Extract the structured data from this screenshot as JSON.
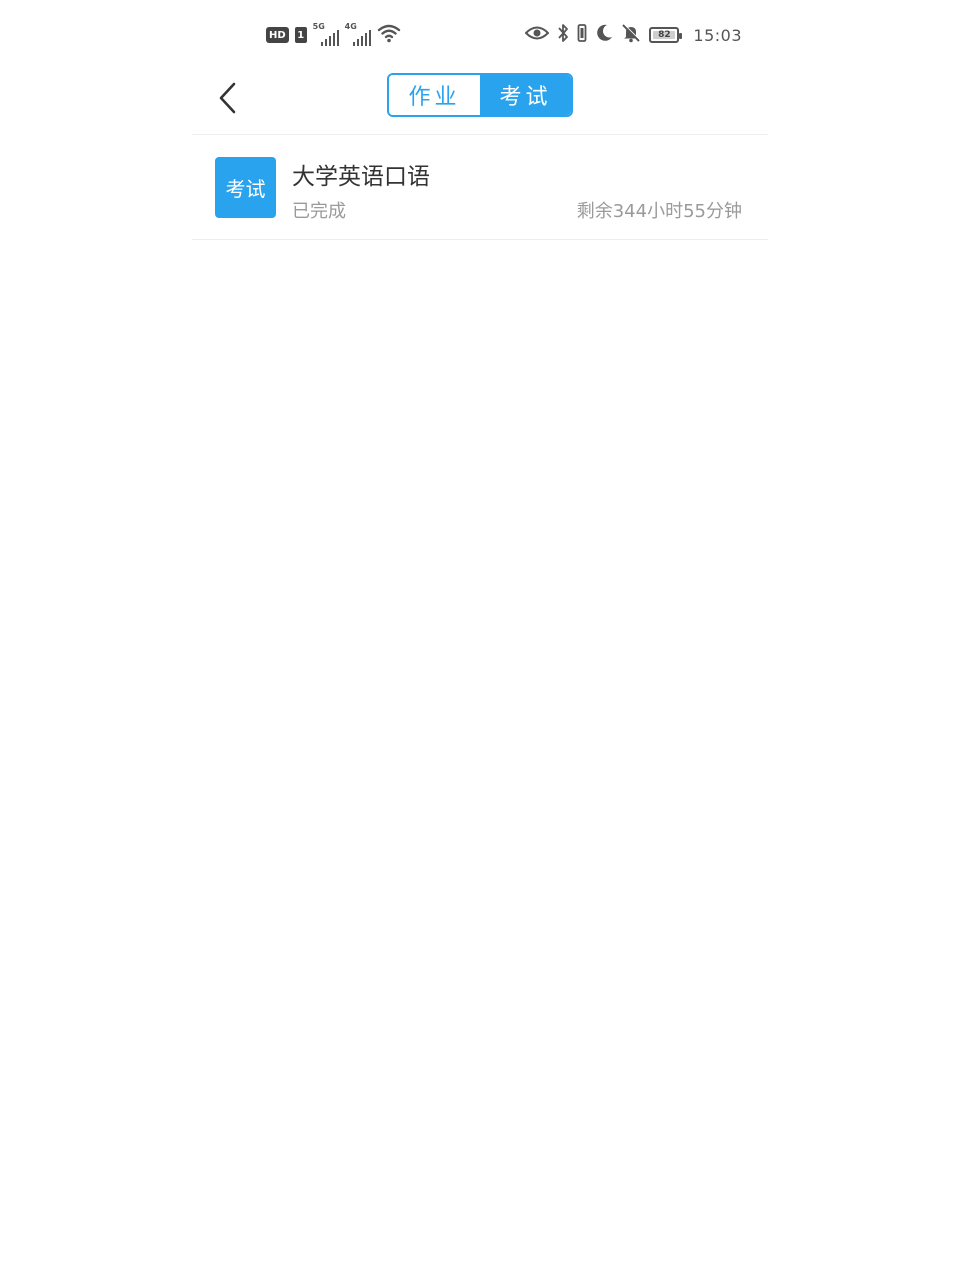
{
  "status_bar": {
    "hd_label": "HD",
    "sim_label": "1",
    "net1_label": "5G",
    "net2_label": "4G",
    "battery_level": "82",
    "time": "15:03",
    "icons": [
      "wifi-icon",
      "eye-icon",
      "bluetooth-icon",
      "vibrate-icon",
      "moon-icon",
      "mute-bell-icon",
      "battery-icon"
    ]
  },
  "header": {
    "back_icon": "chevron-left-icon",
    "tabs": [
      {
        "label": "作业",
        "active": false
      },
      {
        "label": "考试",
        "active": true
      }
    ]
  },
  "list": {
    "items": [
      {
        "badge": "考试",
        "title": "大学英语口语",
        "status": "已完成",
        "remaining": "剩余344小时55分钟"
      }
    ]
  },
  "colors": {
    "accent": "#2aa3ef",
    "text_primary": "#333333",
    "text_secondary": "#9a9a9a",
    "divider": "#eeeeee"
  }
}
